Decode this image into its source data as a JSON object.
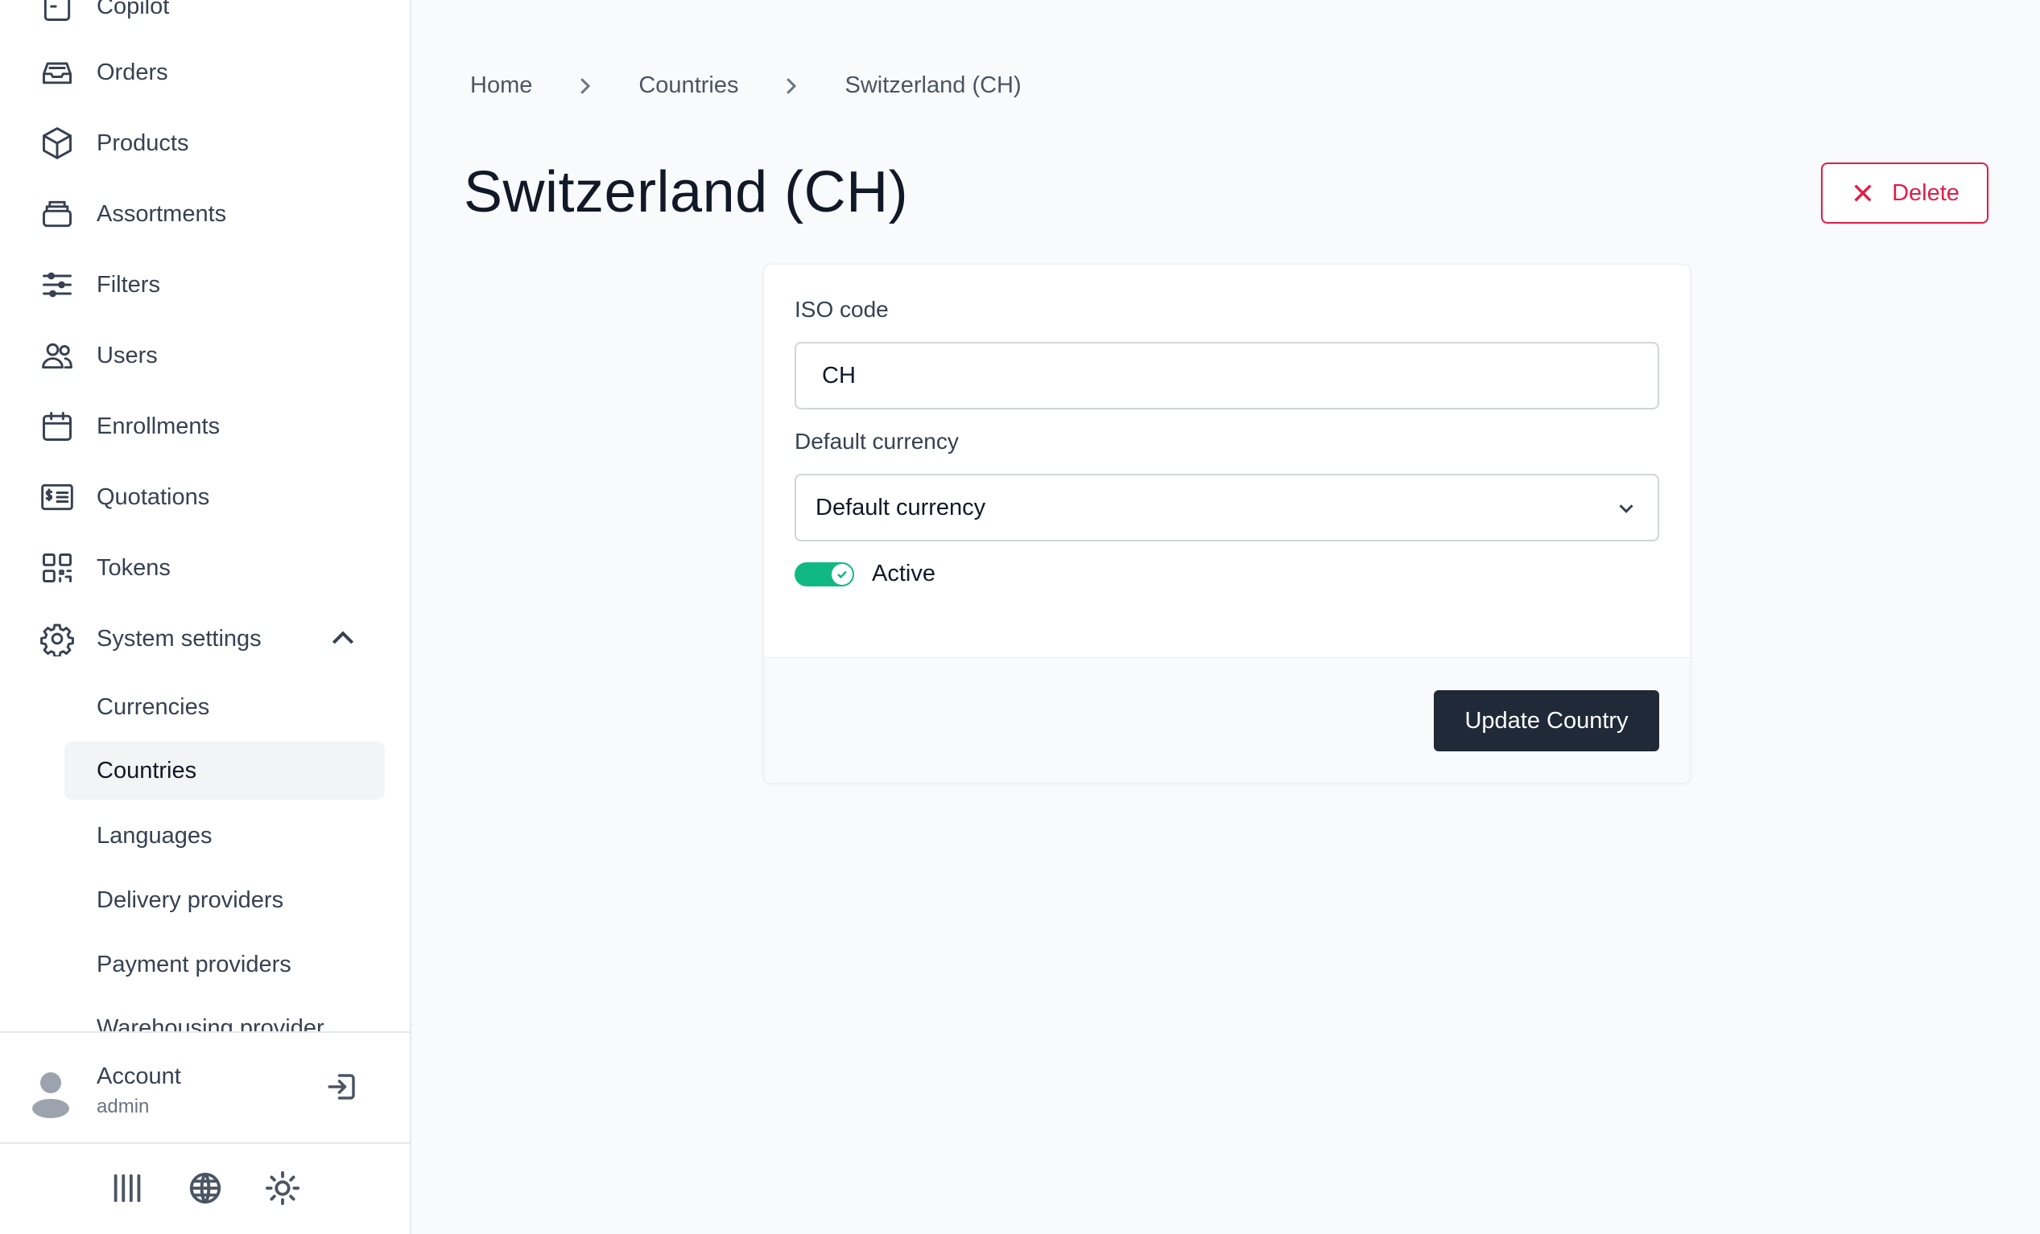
{
  "sidebar": {
    "items": [
      {
        "label": "Copilot",
        "icon": "copilot-icon"
      },
      {
        "label": "Orders",
        "icon": "inbox-icon"
      },
      {
        "label": "Products",
        "icon": "cube-icon"
      },
      {
        "label": "Assortments",
        "icon": "stack-icon"
      },
      {
        "label": "Filters",
        "icon": "sliders-icon"
      },
      {
        "label": "Users",
        "icon": "users-icon"
      },
      {
        "label": "Enrollments",
        "icon": "calendar-icon"
      },
      {
        "label": "Quotations",
        "icon": "quotation-icon"
      },
      {
        "label": "Tokens",
        "icon": "qr-code-icon"
      },
      {
        "label": "System settings",
        "icon": "gear-icon"
      }
    ],
    "sub_items": [
      {
        "label": "Currencies"
      },
      {
        "label": "Countries",
        "active": true
      },
      {
        "label": "Languages"
      },
      {
        "label": "Delivery providers"
      },
      {
        "label": "Payment providers"
      },
      {
        "label": "Warehousing provider"
      }
    ]
  },
  "account": {
    "name": "Account",
    "role": "admin"
  },
  "breadcrumb": [
    "Home",
    "Countries",
    "Switzerland (CH)"
  ],
  "page": {
    "title": "Switzerland (CH)",
    "delete_label": "Delete"
  },
  "form": {
    "iso_label": "ISO code",
    "iso_value": "CH",
    "currency_label": "Default currency",
    "currency_value": "Default currency",
    "active_label": "Active",
    "active": true,
    "submit_label": "Update Country"
  },
  "colors": {
    "accent_danger": "#e11d48",
    "toggle_on": "#10b981",
    "primary_button": "#1f2937"
  }
}
